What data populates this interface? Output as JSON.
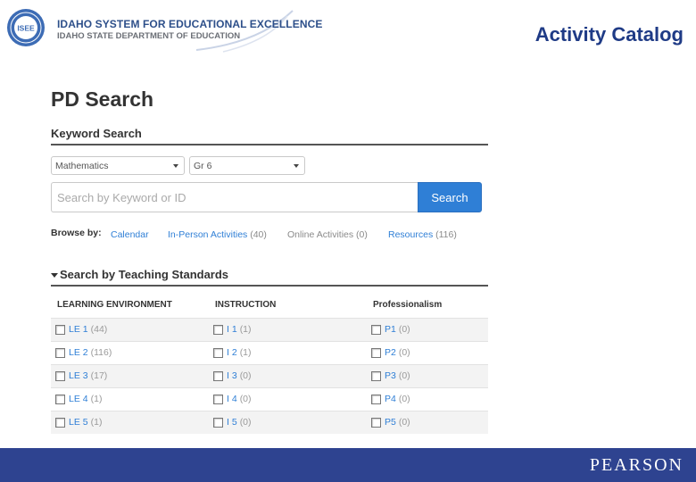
{
  "header": {
    "logo_line_1": "IDAHO SYSTEM FOR EDUCATIONAL EXCELLENCE",
    "logo_line_2": "IDAHO STATE DEPARTMENT OF EDUCATION",
    "seal_text": "ISEE",
    "slide_title": "Activity Catalog"
  },
  "page": {
    "title": "PD Search"
  },
  "keyword_search": {
    "heading": "Keyword Search",
    "subject_select": "Mathematics",
    "grade_select": "Gr 6",
    "search_placeholder": "Search by Keyword or ID",
    "search_button": "Search"
  },
  "browse": {
    "label": "Browse by:",
    "links": [
      {
        "label": "Calendar",
        "count": ""
      },
      {
        "label": "In-Person Activities",
        "count": "(40)"
      },
      {
        "label": "Online Activities",
        "count": "(0)"
      },
      {
        "label": "Resources",
        "count": "(116)"
      }
    ]
  },
  "standards": {
    "heading": "Search by Teaching Standards",
    "columns": [
      "LEARNING ENVIRONMENT",
      "INSTRUCTION",
      "Professionalism"
    ],
    "rows": [
      [
        {
          "label": "LE 1",
          "count": "(44)"
        },
        {
          "label": "I 1",
          "count": "(1)"
        },
        {
          "label": "P1",
          "count": "(0)"
        }
      ],
      [
        {
          "label": "LE 2",
          "count": "(116)"
        },
        {
          "label": "I 2",
          "count": "(1)"
        },
        {
          "label": "P2",
          "count": "(0)"
        }
      ],
      [
        {
          "label": "LE 3",
          "count": "(17)"
        },
        {
          "label": "I 3",
          "count": "(0)"
        },
        {
          "label": "P3",
          "count": "(0)"
        }
      ],
      [
        {
          "label": "LE 4",
          "count": "(1)"
        },
        {
          "label": "I 4",
          "count": "(0)"
        },
        {
          "label": "P4",
          "count": "(0)"
        }
      ],
      [
        {
          "label": "LE 5",
          "count": "(1)"
        },
        {
          "label": "I 5",
          "count": "(0)"
        },
        {
          "label": "P5",
          "count": "(0)"
        }
      ]
    ]
  },
  "footer": {
    "brand": "PEARSON"
  },
  "colors": {
    "link": "#2f7fd6",
    "button": "#2f7fd6",
    "slide_title": "#1f3b86",
    "footer_bar": "#2e4390"
  }
}
